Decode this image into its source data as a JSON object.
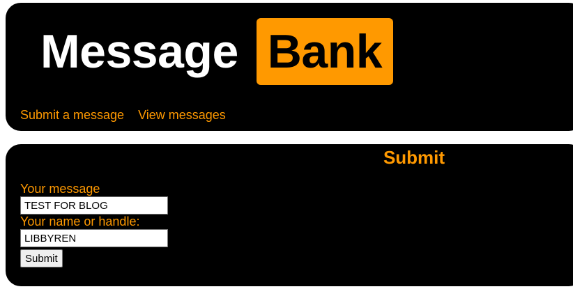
{
  "logo": {
    "text_white": "Message",
    "text_box": "Bank"
  },
  "nav": {
    "items": [
      {
        "label": "Submit a message"
      },
      {
        "label": "View messages"
      }
    ]
  },
  "form": {
    "title": "Submit",
    "message_label": "Your message",
    "message_value": "TEST FOR BLOG",
    "name_label": "Your name or handle:",
    "name_value": "LIBBYREN",
    "submit_label": "Submit"
  },
  "colors": {
    "accent": "#ff9900",
    "panel": "#000000",
    "background": "#ffffff"
  }
}
